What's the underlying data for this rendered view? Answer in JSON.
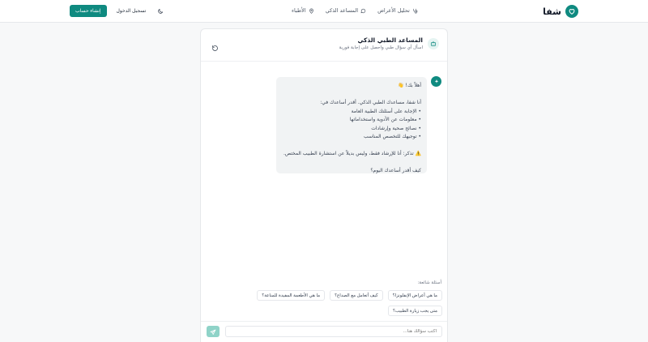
{
  "header": {
    "brand": "شفا",
    "nav": {
      "symptoms": "تحليل الأعراض",
      "assistant": "المساعد الذكي",
      "doctors": "الأطباء"
    },
    "login": "تسجيل الدخول",
    "signup": "إنشاء حساب"
  },
  "chat": {
    "title": "المساعد الطبي الذكي",
    "subtitle": "اسأل أي سؤال طبي واحصل على إجابة فورية",
    "message": {
      "greeting": "أهلاً بك! 👋",
      "intro": "أنا شفا، مساعدك الطبي الذكي. أقدر أساعدك في:",
      "items": [
        "• الإجابة على أسئلتك الطبية العامة",
        "• معلومات عن الأدوية واستخداماتها",
        "• نصائح صحية وإرشادات",
        "• توجيهك للتخصص المناسب"
      ],
      "disclaimer": "⚠️ تذكر: أنا للإرشاد فقط، وليس بديلاً عن استشارة الطبيب المختص.",
      "question": "كيف أقدر أساعدك اليوم؟"
    },
    "suggestions_title": "أسئلة شائعة:",
    "suggestions": [
      "ما هي أعراض الإنفلونزا؟",
      "كيف أتعامل مع الصداع؟",
      "ما هي الأطعمة المفيدة للمناعة؟",
      "متى يجب زيارة الطبيب؟"
    ],
    "input_placeholder": "اكتب سؤالك هنا..."
  },
  "colors": {
    "primary": "#0f8a80",
    "send_disabled": "#8fd3c8"
  }
}
